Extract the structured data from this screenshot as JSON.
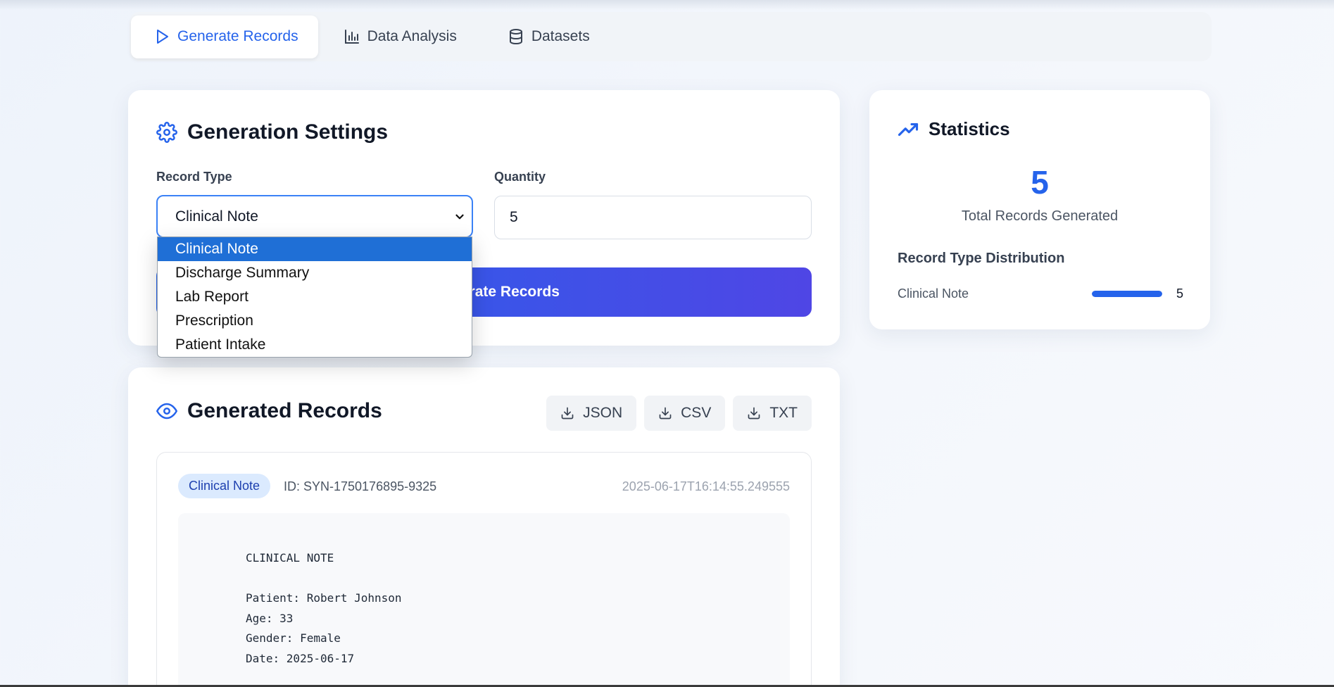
{
  "tabs": [
    {
      "label": "Generate Records",
      "icon": "play-icon",
      "active": true
    },
    {
      "label": "Data Analysis",
      "icon": "bar-chart-icon",
      "active": false
    },
    {
      "label": "Datasets",
      "icon": "database-icon",
      "active": false
    }
  ],
  "settings": {
    "title": "Generation Settings",
    "record_type_label": "Record Type",
    "record_type_value": "Clinical Note",
    "quantity_label": "Quantity",
    "quantity_value": "5",
    "generate_button_label": "Generate Records",
    "dropdown_options": [
      "Clinical Note",
      "Discharge Summary",
      "Lab Report",
      "Prescription",
      "Patient Intake"
    ],
    "dropdown_selected": "Clinical Note"
  },
  "stats": {
    "title": "Statistics",
    "total_value": "5",
    "total_label": "Total Records Generated",
    "distribution_title": "Record Type Distribution",
    "distribution": [
      {
        "name": "Clinical Note",
        "count": "5",
        "fraction": 1.0
      }
    ]
  },
  "records": {
    "title": "Generated Records",
    "export_buttons": [
      "JSON",
      "CSV",
      "TXT"
    ],
    "items": [
      {
        "badge": "Clinical Note",
        "id": "ID: SYN-1750176895-9325",
        "timestamp": "2025-06-17T16:14:55.249555",
        "content_lines": [
          "CLINICAL NOTE",
          "",
          "Patient: Robert Johnson",
          "Age: 33",
          "Gender: Female",
          "Date: 2025-06-17"
        ]
      }
    ]
  },
  "colors": {
    "accent": "#2563eb",
    "gradient_end": "#4f46e5",
    "badge_bg": "#dbeafe",
    "dropdown_highlight": "#1f6fd6"
  }
}
